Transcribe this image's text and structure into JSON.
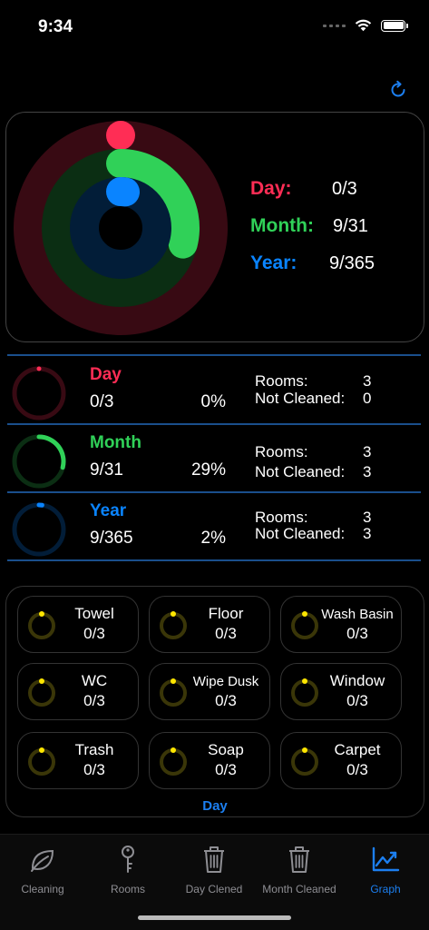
{
  "status": {
    "time": "9:34"
  },
  "colors": {
    "day": "#ff2d55",
    "month": "#30d158",
    "year": "#0a84ff",
    "accent": "#1c7ff0",
    "tile_ring": "#ffe600"
  },
  "summary": {
    "day": {
      "label": "Day:",
      "value": "0/3",
      "fraction": 0
    },
    "month": {
      "label": "Month:",
      "value": "9/31",
      "fraction": 0.29
    },
    "year": {
      "label": "Year:",
      "value": "9/365",
      "fraction": 0.02
    }
  },
  "rows": [
    {
      "title": "Day",
      "value": "0/3",
      "percent": "0%",
      "fraction": 0,
      "stat1_label": "Rooms:",
      "stat1_value": "3",
      "stat2_label": "Not Cleaned:",
      "stat2_value": "0"
    },
    {
      "title": "Month",
      "value": "9/31",
      "percent": "29%",
      "fraction": 0.29,
      "stat1_label": "Rooms:",
      "stat1_value": "3",
      "stat2_label": "Not Cleaned:",
      "stat2_value": "3"
    },
    {
      "title": "Year",
      "value": "9/365",
      "percent": "2%",
      "fraction": 0.02,
      "stat1_label": "Rooms:",
      "stat1_value": "3",
      "stat2_label": "Not Cleaned:",
      "stat2_value": "3"
    }
  ],
  "tiles": [
    {
      "name": "Towel",
      "value": "0/3"
    },
    {
      "name": "Floor",
      "value": "0/3"
    },
    {
      "name": "Wash Basin",
      "value": "0/3"
    },
    {
      "name": "WC",
      "value": "0/3"
    },
    {
      "name": "Wipe Dusk",
      "value": "0/3"
    },
    {
      "name": "Window",
      "value": "0/3"
    },
    {
      "name": "Trash",
      "value": "0/3"
    },
    {
      "name": "Soap",
      "value": "0/3"
    },
    {
      "name": "Carpet",
      "value": "0/3"
    }
  ],
  "tiles_footer": "Day",
  "tabs": [
    {
      "label": "Cleaning",
      "icon": "leaf-icon",
      "active": false
    },
    {
      "label": "Rooms",
      "icon": "key-icon",
      "active": false
    },
    {
      "label": "Day Clened",
      "icon": "trash-icon",
      "active": false
    },
    {
      "label": "Month Cleaned",
      "icon": "trash-icon",
      "active": false
    },
    {
      "label": "Graph",
      "icon": "chart-icon",
      "active": true
    }
  ]
}
